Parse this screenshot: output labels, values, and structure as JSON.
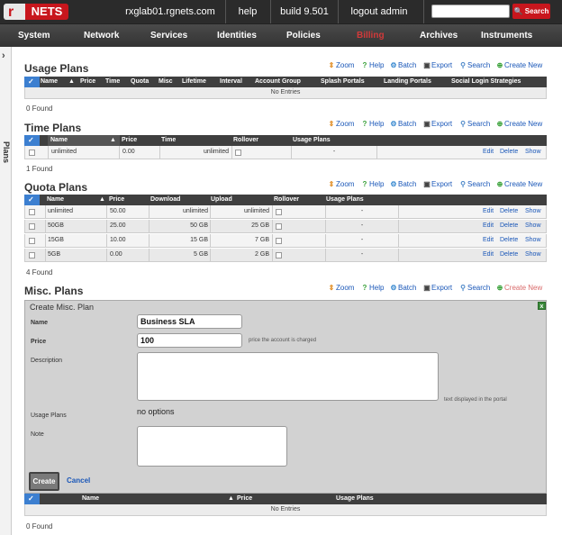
{
  "topbar": {
    "logo_text": "NETS",
    "logo_mark": "r",
    "host": "rxglab01.rgnets.com",
    "help": "help",
    "build": "build 9.501",
    "logout": "logout admin",
    "search_placeholder": "",
    "search_button": "Search"
  },
  "nav": {
    "items": [
      "System",
      "Network",
      "Services",
      "Identities",
      "Policies",
      "Billing",
      "Archives",
      "Instruments"
    ],
    "active": "Billing"
  },
  "sidebar": {
    "label": "Plans"
  },
  "actions": {
    "zoom": "Zoom",
    "help": "Help",
    "batch": "Batch",
    "export": "Export",
    "search": "Search",
    "create": "Create New"
  },
  "usage_plans": {
    "title": "Usage Plans",
    "columns": [
      "Name",
      "Price",
      "Time",
      "Quota",
      "Misc",
      "Lifetime",
      "Interval",
      "Account Group",
      "Splash Portals",
      "Landing Portals",
      "Social Login Strategies"
    ],
    "empty": "No Entries",
    "found": "0 Found"
  },
  "time_plans": {
    "title": "Time Plans",
    "columns": [
      "Name",
      "Price",
      "Time",
      "Rollover",
      "Usage Plans"
    ],
    "rows": [
      {
        "name": "unlimited",
        "price": "0.00",
        "time": "unlimited",
        "usage": "-"
      }
    ],
    "found": "1 Found"
  },
  "quota_plans": {
    "title": "Quota Plans",
    "columns": [
      "Name",
      "Price",
      "Download",
      "Upload",
      "Rollover",
      "Usage Plans"
    ],
    "rows": [
      {
        "name": "unlimited",
        "price": "50.00",
        "download": "unlimited",
        "upload": "unlimited",
        "usage": "-"
      },
      {
        "name": "50GB",
        "price": "25.00",
        "download": "50 GB",
        "upload": "25 GB",
        "usage": "-"
      },
      {
        "name": "15GB",
        "price": "10.00",
        "download": "15 GB",
        "upload": "7 GB",
        "usage": "-"
      },
      {
        "name": "5GB",
        "price": "0.00",
        "download": "5 GB",
        "upload": "2 GB",
        "usage": "-"
      }
    ],
    "found": "4 Found"
  },
  "row_actions": {
    "edit": "Edit",
    "delete": "Delete",
    "show": "Show"
  },
  "misc_plans": {
    "title": "Misc. Plans",
    "form": {
      "title": "Create Misc. Plan",
      "close": "x",
      "name_label": "Name",
      "name_value": "Business SLA",
      "price_label": "Price",
      "price_value": "100",
      "price_hint": "price the account is charged",
      "description_label": "Description",
      "description_hint": "text displayed in the portal",
      "usage_label": "Usage Plans",
      "usage_value": "no options",
      "note_label": "Note",
      "create_button": "Create",
      "cancel_link": "Cancel"
    },
    "columns": [
      "Name",
      "Price",
      "Usage Plans"
    ],
    "empty": "No Entries",
    "found": "0 Found"
  },
  "colors": {
    "brand_red": "#c8161d",
    "link_blue": "#1a57b8",
    "header_dark": "#3f3f3f",
    "select_blue": "#3c7fd0"
  }
}
